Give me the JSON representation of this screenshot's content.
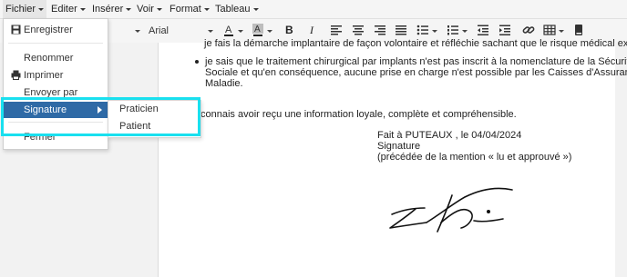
{
  "menubar": [
    "Fichier",
    "Editer",
    "Insérer",
    "Voir",
    "Format",
    "Tableau"
  ],
  "toolbar": {
    "font_family": "Arial"
  },
  "file_menu": {
    "items": [
      "Enregistrer",
      "Renommer",
      "Imprimer",
      "Envoyer par email...",
      "Signature",
      "Fermer"
    ],
    "selected": "Signature"
  },
  "signature_submenu": [
    "Praticien",
    "Patient"
  ],
  "document": {
    "line_cut": "je fais la démarche implantaire de façon volontaire et réfléchie sachant que le risque médical existe.",
    "bullet2_l1": "je sais que le traitement chirurgical par implants n'est pas inscrit à la nomenclature de la Sécurité",
    "bullet2_l2": "Sociale et qu'en conséquence, aucune prise en charge n'est possible par les Caisses d'Assurance",
    "bullet2_l3": "Maladie.",
    "recognition": "connais avoir reçu une information loyale, complète et compréhensible.",
    "place_date": "Fait à PUTEAUX , le 04/04/2024",
    "signature_label": "Signature",
    "mention": "(précédée de la mention « lu et approuvé »)"
  }
}
